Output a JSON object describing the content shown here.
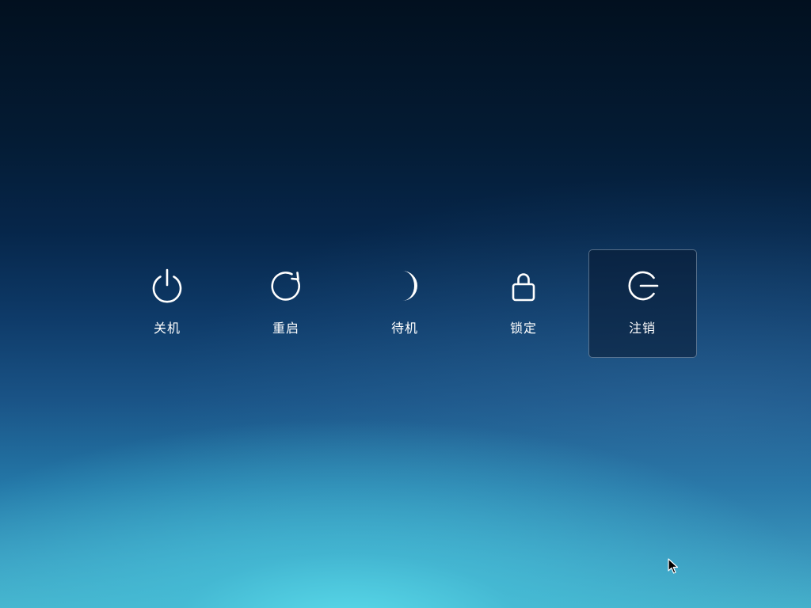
{
  "power_menu": {
    "items": [
      {
        "label": "关机",
        "icon": "power-icon"
      },
      {
        "label": "重启",
        "icon": "restart-icon"
      },
      {
        "label": "待机",
        "icon": "moon-icon"
      },
      {
        "label": "锁定",
        "icon": "lock-icon"
      },
      {
        "label": "注销",
        "icon": "logout-icon"
      }
    ],
    "selected_index": 4
  },
  "colors": {
    "icon": "#ffffff",
    "label": "#ffffff",
    "focus_border": "#8fa2b8",
    "background_top": "#02101f",
    "background_bottom_glow": "#5ad6e6"
  }
}
